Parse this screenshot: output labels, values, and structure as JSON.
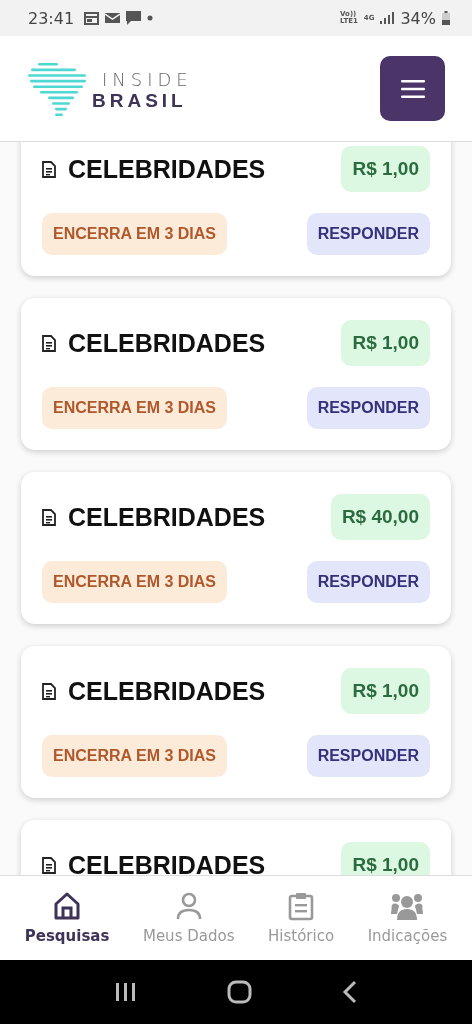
{
  "status_bar": {
    "time": "23:41",
    "network_lines": [
      "Vo))",
      "LTE1"
    ],
    "network_type": "4G",
    "battery": "34%"
  },
  "header": {
    "logo_top": "INSIDE",
    "logo_bottom": "BRASIL"
  },
  "surveys": [
    {
      "title": "CELEBRIDADES",
      "reward": "R$ 1,00",
      "deadline": "ENCERRA EM 3 DIAS",
      "action": "RESPONDER"
    },
    {
      "title": "CELEBRIDADES",
      "reward": "R$ 1,00",
      "deadline": "ENCERRA EM 3 DIAS",
      "action": "RESPONDER"
    },
    {
      "title": "CELEBRIDADES",
      "reward": "R$ 40,00",
      "deadline": "ENCERRA EM 3 DIAS",
      "action": "RESPONDER"
    },
    {
      "title": "CELEBRIDADES",
      "reward": "R$ 1,00",
      "deadline": "ENCERRA EM 3 DIAS",
      "action": "RESPONDER"
    },
    {
      "title": "CELEBRIDADES",
      "reward": "R$ 1,00"
    }
  ],
  "bottom_nav": [
    {
      "label": "Pesquisas",
      "kind": "home",
      "selected": true
    },
    {
      "label": "Meus Dados",
      "kind": "person",
      "selected": false
    },
    {
      "label": "Histórico",
      "kind": "clipboard",
      "selected": false
    },
    {
      "label": "Indicações",
      "kind": "group",
      "selected": false
    }
  ]
}
